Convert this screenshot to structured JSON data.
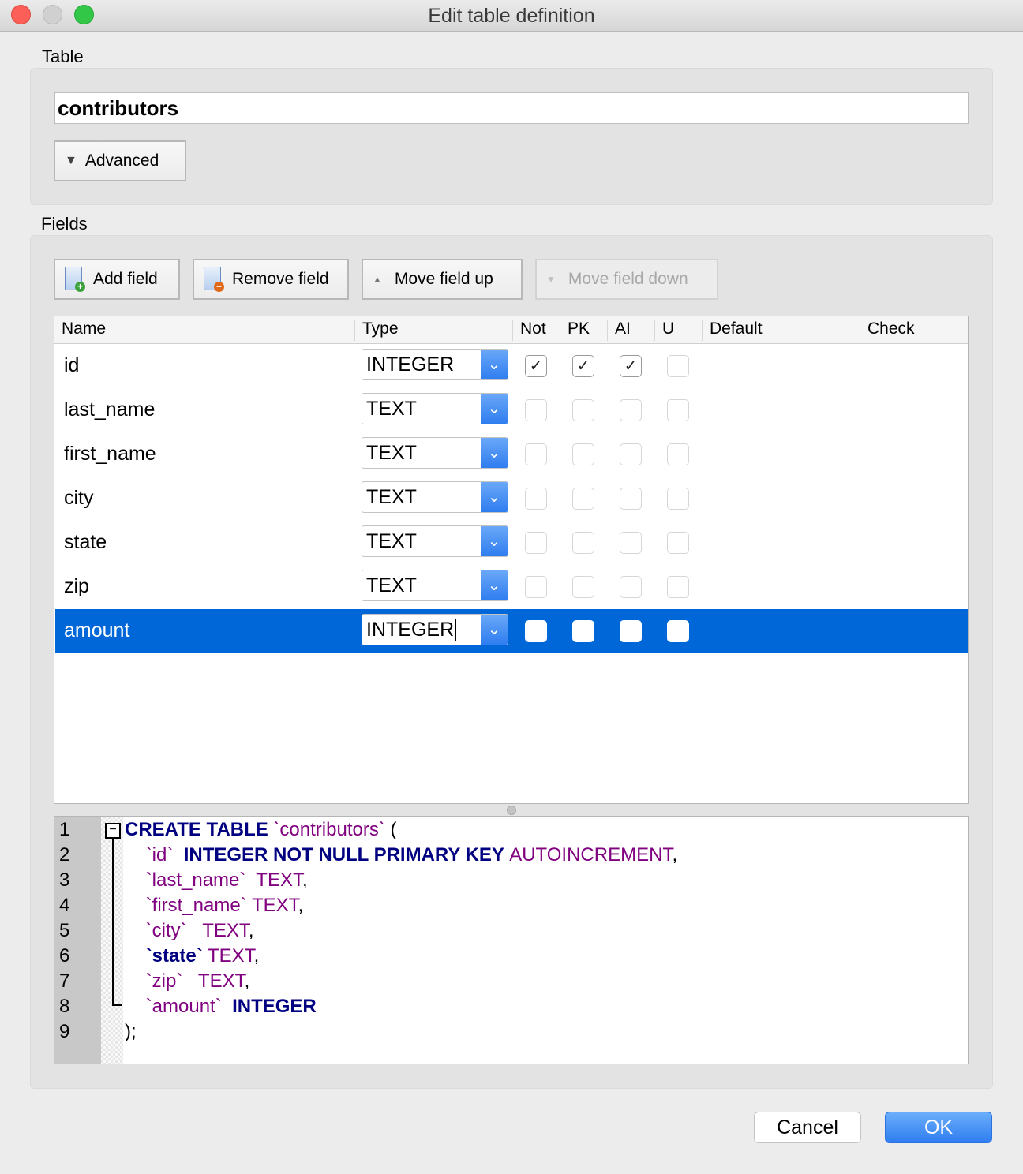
{
  "window": {
    "title": "Edit table definition"
  },
  "table_section": {
    "label": "Table",
    "name_value": "contributors",
    "advanced_label": "Advanced"
  },
  "fields_section": {
    "label": "Fields",
    "toolbar": {
      "add": "Add field",
      "remove": "Remove field",
      "up": "Move field up",
      "down": "Move field down"
    },
    "columns": [
      "Name",
      "Type",
      "Not",
      "PK",
      "AI",
      "U",
      "Default",
      "Check"
    ],
    "rows": [
      {
        "name": "id",
        "type": "INTEGER",
        "not": true,
        "pk": true,
        "ai": true,
        "u": false
      },
      {
        "name": "last_name",
        "type": "TEXT",
        "not": false,
        "pk": false,
        "ai": false,
        "u": false
      },
      {
        "name": "first_name",
        "type": "TEXT",
        "not": false,
        "pk": false,
        "ai": false,
        "u": false
      },
      {
        "name": "city",
        "type": "TEXT",
        "not": false,
        "pk": false,
        "ai": false,
        "u": false
      },
      {
        "name": "state",
        "type": "TEXT",
        "not": false,
        "pk": false,
        "ai": false,
        "u": false
      },
      {
        "name": "zip",
        "type": "TEXT",
        "not": false,
        "pk": false,
        "ai": false,
        "u": false
      },
      {
        "name": "amount",
        "type": "INTEGER",
        "not": false,
        "pk": false,
        "ai": false,
        "u": false,
        "selected": true
      }
    ]
  },
  "sql": {
    "lines": [
      [
        [
          "kw",
          "CREATE TABLE "
        ],
        [
          "id",
          "`contributors`"
        ],
        [
          "pn",
          " ("
        ]
      ],
      [
        [
          "pn",
          "    "
        ],
        [
          "id",
          "`id`"
        ],
        [
          "pn",
          "  "
        ],
        [
          "kw",
          "INTEGER NOT NULL PRIMARY KEY "
        ],
        [
          "ty",
          "AUTOINCREMENT"
        ],
        [
          "pn",
          ","
        ]
      ],
      [
        [
          "pn",
          "    "
        ],
        [
          "id",
          "`last_name`"
        ],
        [
          "pn",
          "  "
        ],
        [
          "ty",
          "TEXT"
        ],
        [
          "pn",
          ","
        ]
      ],
      [
        [
          "pn",
          "    "
        ],
        [
          "id",
          "`first_name`"
        ],
        [
          "pn",
          " "
        ],
        [
          "ty",
          "TEXT"
        ],
        [
          "pn",
          ","
        ]
      ],
      [
        [
          "pn",
          "    "
        ],
        [
          "id",
          "`city`"
        ],
        [
          "pn",
          "   "
        ],
        [
          "ty",
          "TEXT"
        ],
        [
          "pn",
          ","
        ]
      ],
      [
        [
          "pn",
          "    "
        ],
        [
          "kw",
          "`state`"
        ],
        [
          "pn",
          " "
        ],
        [
          "ty",
          "TEXT"
        ],
        [
          "pn",
          ","
        ]
      ],
      [
        [
          "pn",
          "    "
        ],
        [
          "id",
          "`zip`"
        ],
        [
          "pn",
          "   "
        ],
        [
          "ty",
          "TEXT"
        ],
        [
          "pn",
          ","
        ]
      ],
      [
        [
          "pn",
          "    "
        ],
        [
          "id",
          "`amount`"
        ],
        [
          "pn",
          "  "
        ],
        [
          "kw",
          "INTEGER"
        ]
      ],
      [
        [
          "pn",
          ");"
        ]
      ]
    ]
  },
  "buttons": {
    "cancel": "Cancel",
    "ok": "OK"
  },
  "colors": {
    "accent": "#0067d8",
    "ok": "#2f7df0"
  }
}
